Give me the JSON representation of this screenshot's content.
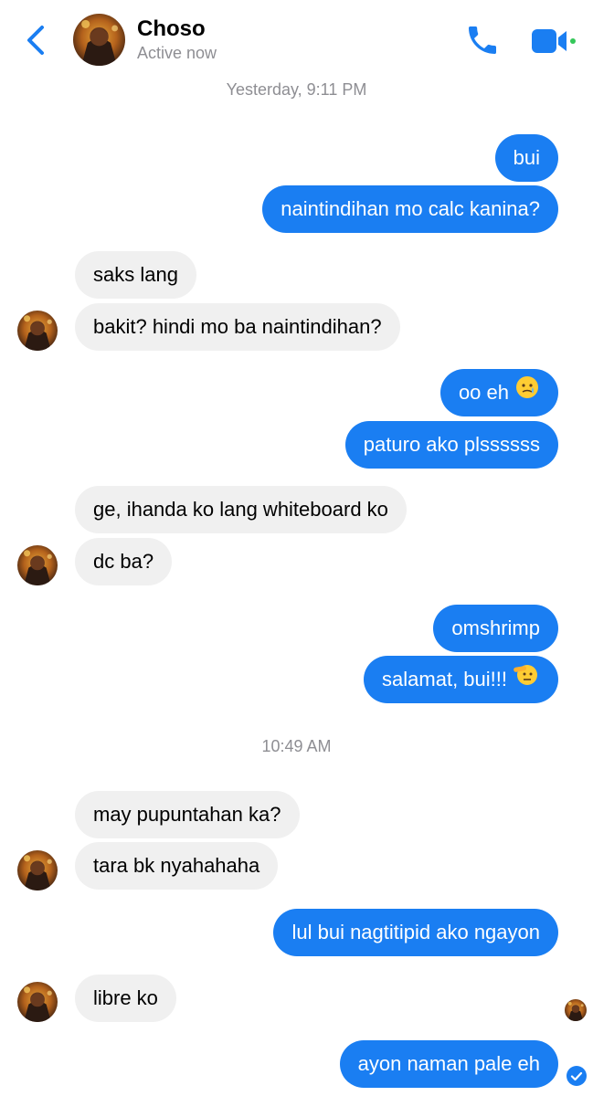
{
  "header": {
    "contact_name": "Choso",
    "status": "Active now",
    "back_icon": "chevron-left-icon",
    "call_icon": "phone-icon",
    "video_icon": "video-camera-icon",
    "accent_color": "#1a7ef2",
    "online_color": "#34c759"
  },
  "timestamps": [
    "Yesterday, 9:11 PM",
    "10:49 AM"
  ],
  "messages": [
    {
      "from": "me",
      "text": "bui"
    },
    {
      "from": "me",
      "text": "naintindihan mo calc kanina?"
    },
    {
      "from": "them",
      "text": "saks lang"
    },
    {
      "from": "them",
      "text": "bakit? hindi mo ba naintindihan?"
    },
    {
      "from": "me",
      "text": "oo eh",
      "emoji": "face-holding-back-tears"
    },
    {
      "from": "me",
      "text": "paturo ako plssssss"
    },
    {
      "from": "them",
      "text": "ge, ihanda ko lang whiteboard ko"
    },
    {
      "from": "them",
      "text": "dc ba?"
    },
    {
      "from": "me",
      "text": "omshrimp"
    },
    {
      "from": "me",
      "text": "salamat, bui!!!",
      "emoji": "saluting-face"
    },
    {
      "from": "them",
      "text": "may pupuntahan ka?"
    },
    {
      "from": "them",
      "text": "tara bk nyahahaha"
    },
    {
      "from": "me",
      "text": "lul bui nagtitipid ako ngayon"
    },
    {
      "from": "them",
      "text": "libre ko"
    },
    {
      "from": "me",
      "text": "ayon naman pale eh"
    }
  ],
  "colors": {
    "outgoing_bubble": "#1a7ef2",
    "incoming_bubble": "#f0f0f0",
    "timestamp_text": "#8e8e93"
  }
}
